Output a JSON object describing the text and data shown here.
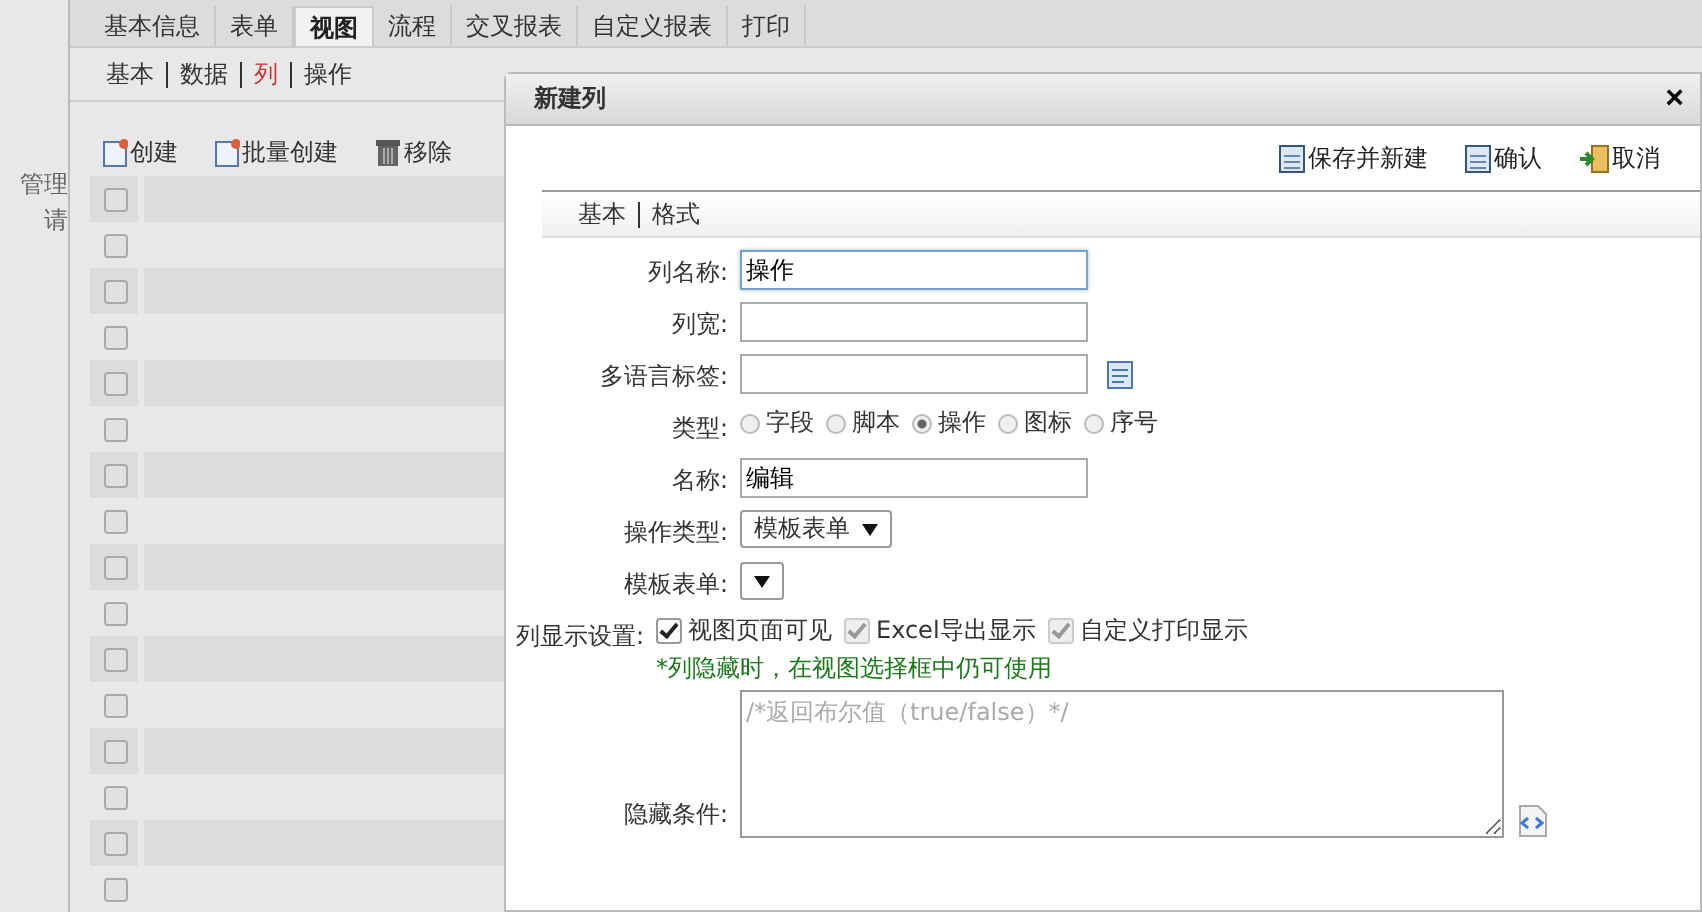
{
  "sidebar": {
    "items": [
      "管理",
      "请"
    ]
  },
  "tabs": [
    {
      "label": "基本信息",
      "selected": false
    },
    {
      "label": "表单",
      "selected": false
    },
    {
      "label": "视图",
      "selected": true
    },
    {
      "label": "流程",
      "selected": false
    },
    {
      "label": "交叉报表",
      "selected": false
    },
    {
      "label": "自定义报表",
      "selected": false
    },
    {
      "label": "打印",
      "selected": false
    }
  ],
  "subtabs": [
    {
      "label": "基本",
      "selected": false
    },
    {
      "label": "数据",
      "selected": false
    },
    {
      "label": "列",
      "selected": true
    },
    {
      "label": "操作",
      "selected": false
    }
  ],
  "toolbar": [
    {
      "label": "创建",
      "kind": "new"
    },
    {
      "label": "批量创建",
      "kind": "new"
    },
    {
      "label": "移除",
      "kind": "trash"
    }
  ],
  "rows": [
    {
      "checked": false
    },
    {
      "checked": false
    },
    {
      "checked": false
    },
    {
      "checked": false
    },
    {
      "checked": false
    },
    {
      "checked": false
    },
    {
      "checked": false
    },
    {
      "checked": false
    },
    {
      "checked": false
    },
    {
      "checked": false
    },
    {
      "checked": false
    },
    {
      "checked": false
    },
    {
      "checked": false
    },
    {
      "checked": false
    },
    {
      "checked": false
    },
    {
      "checked": false
    }
  ],
  "dialog": {
    "title": "新建列",
    "close": "×",
    "actions": [
      {
        "label": "保存并新建",
        "kind": "save"
      },
      {
        "label": "确认",
        "kind": "save"
      },
      {
        "label": "取消",
        "kind": "exit"
      }
    ],
    "tabs": [
      "基本",
      "格式"
    ],
    "fields": [
      {
        "kind": "text",
        "label": "列名称:",
        "value": "操作",
        "focused": true
      },
      {
        "kind": "text",
        "label": "列宽:",
        "focused": false
      },
      {
        "kind": "lang",
        "label": "多语言标签:",
        "focused": false
      },
      {
        "kind": "radio",
        "label": "类型:",
        "options": [
          {
            "label": "字段",
            "selected": false
          },
          {
            "label": "脚本",
            "selected": false
          },
          {
            "label": "操作",
            "selected": true
          },
          {
            "label": "图标",
            "selected": false
          },
          {
            "label": "序号",
            "selected": false
          }
        ]
      },
      {
        "kind": "text",
        "label": "名称:",
        "value": "编辑",
        "focused": false
      },
      {
        "kind": "select",
        "label": "操作类型:",
        "value": "模板表单"
      },
      {
        "kind": "select",
        "label": "模板表单:"
      },
      {
        "kind": "checks",
        "label": "列显示设置:",
        "options": [
          {
            "label": "视图页面可见",
            "checked": true,
            "disabled": false
          },
          {
            "label": "Excel导出显示",
            "checked": true,
            "disabled": true
          },
          {
            "label": "自定义打印显示",
            "checked": true,
            "disabled": true
          }
        ],
        "note": "*列隐藏时，在视图选择框中仍可使用"
      },
      {
        "kind": "textarea",
        "label": "隐藏条件:",
        "placeholder": "/*返回布尔值（true/false）*/"
      }
    ]
  }
}
